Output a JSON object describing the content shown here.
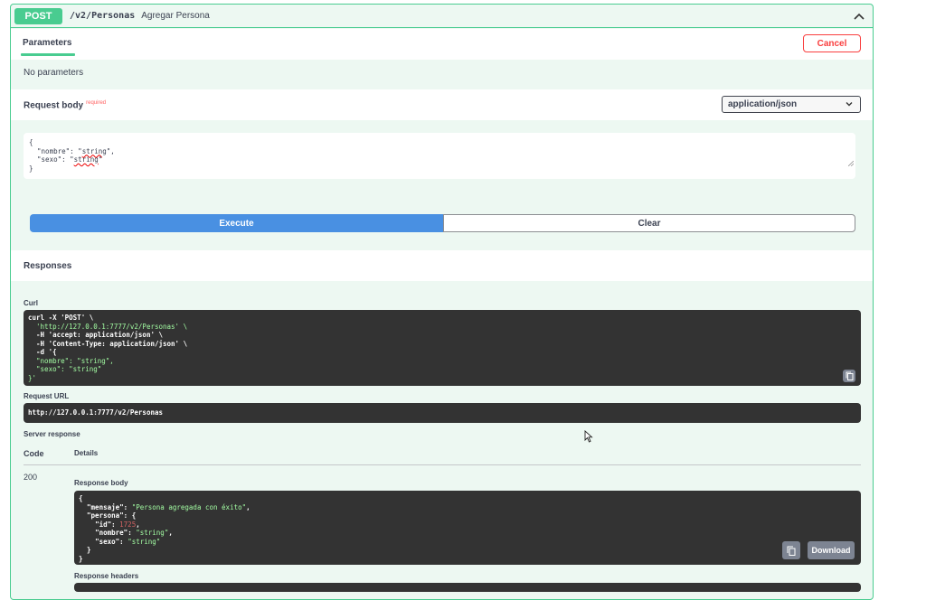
{
  "summary": {
    "method": "POST",
    "path": "/v2/Personas",
    "description": "Agregar Persona"
  },
  "parameters": {
    "tab_label": "Parameters",
    "cancel_label": "Cancel",
    "empty_text": "No parameters"
  },
  "request_body": {
    "label": "Request body",
    "required_label": "required",
    "content_type": "application/json",
    "lines": [
      "{",
      "  \"nombre\": \"string\",",
      "  \"sexo\": \"string\"",
      "}"
    ]
  },
  "actions": {
    "execute_label": "Execute",
    "clear_label": "Clear"
  },
  "responses": {
    "title": "Responses",
    "curl_label": "Curl",
    "curl_lines": [
      "curl -X 'POST' \\",
      "  'http://127.0.0.1:7777/v2/Personas' \\",
      "  -H 'accept: application/json' \\",
      "  -H 'Content-Type: application/json' \\",
      "  -d '{",
      "  \"nombre\": \"string\",",
      "  \"sexo\": \"string\"",
      "}'"
    ],
    "request_url_label": "Request URL",
    "request_url": "http://127.0.0.1:7777/v2/Personas",
    "server_response_label": "Server response",
    "code_header": "Code",
    "details_header": "Details",
    "code": "200",
    "response_body_label": "Response body",
    "body": {
      "mensaje_key": "\"mensaje\"",
      "mensaje_val": "\"Persona agregada con éxito\"",
      "persona_key": "\"persona\"",
      "id_key": "\"id\"",
      "id_val": "1725",
      "nombre_key": "\"nombre\"",
      "nombre_val": "\"string\"",
      "sexo_key": "\"sexo\"",
      "sexo_val": "\"string\""
    },
    "download_label": "Download",
    "response_headers_label": "Response headers"
  },
  "colors": {
    "post": "#49cc90",
    "execute": "#4990e2",
    "cancel": "#f93e3e",
    "code_bg": "#333333"
  }
}
